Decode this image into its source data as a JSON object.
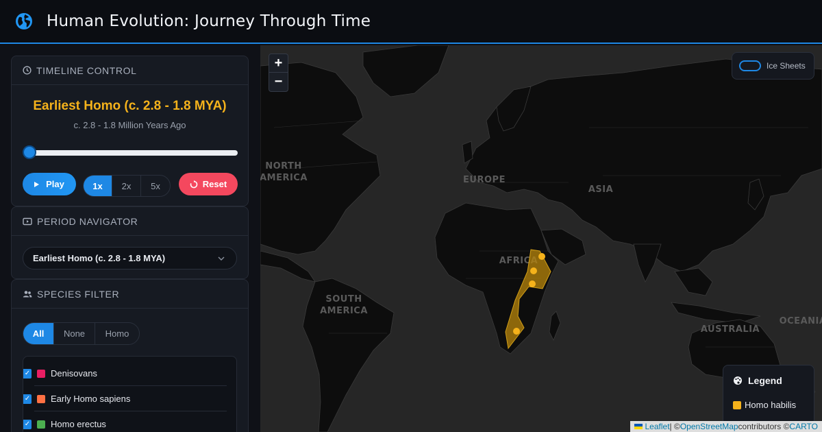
{
  "header": {
    "title": "Human Evolution: Journey Through Time",
    "icon": "globe-icon"
  },
  "timeline": {
    "heading": "Timeline Control",
    "period_title": "Earliest Homo (c. 2.8 - 1.8 MYA)",
    "period_subtitle": "c. 2.8 - 1.8 Million Years Ago",
    "slider_position": 0.0,
    "play_label": "Play",
    "speeds": [
      "1x",
      "2x",
      "5x"
    ],
    "active_speed": "1x",
    "reset_label": "Reset"
  },
  "navigator": {
    "heading": "Period Navigator",
    "selected": "Earliest Homo (c. 2.8 - 1.8 MYA)"
  },
  "species_filter": {
    "heading": "Species Filter",
    "filters": [
      "All",
      "None",
      "Homo"
    ],
    "active_filter": "All",
    "items": [
      {
        "label": "Denisovans",
        "color": "#e91e63",
        "checked": true
      },
      {
        "label": "Early Homo sapiens",
        "color": "#ff7043",
        "checked": true
      },
      {
        "label": "Homo erectus",
        "color": "#4caf50",
        "checked": true
      }
    ]
  },
  "map": {
    "zoom_in": "+",
    "zoom_out": "−",
    "ice_toggle_label": "Ice Sheets",
    "ice_enabled": false,
    "labels": {
      "north_america": "NORTH\nAMERICA",
      "europe": "EUROPE",
      "asia": "ASIA",
      "africa": "AFRICA",
      "south_america": "SOUTH\nAMERICA",
      "australia": "AUSTRALIA",
      "oceania": "OCEANIA"
    },
    "legend": {
      "title": "Legend",
      "items": [
        {
          "label": "Homo habilis",
          "color": "#f5b21b"
        }
      ]
    },
    "attribution": {
      "leaflet": "Leaflet",
      "sep": " | © ",
      "osm": "OpenStreetMap",
      "contrib": " contributors © ",
      "carto": "CARTO"
    }
  }
}
